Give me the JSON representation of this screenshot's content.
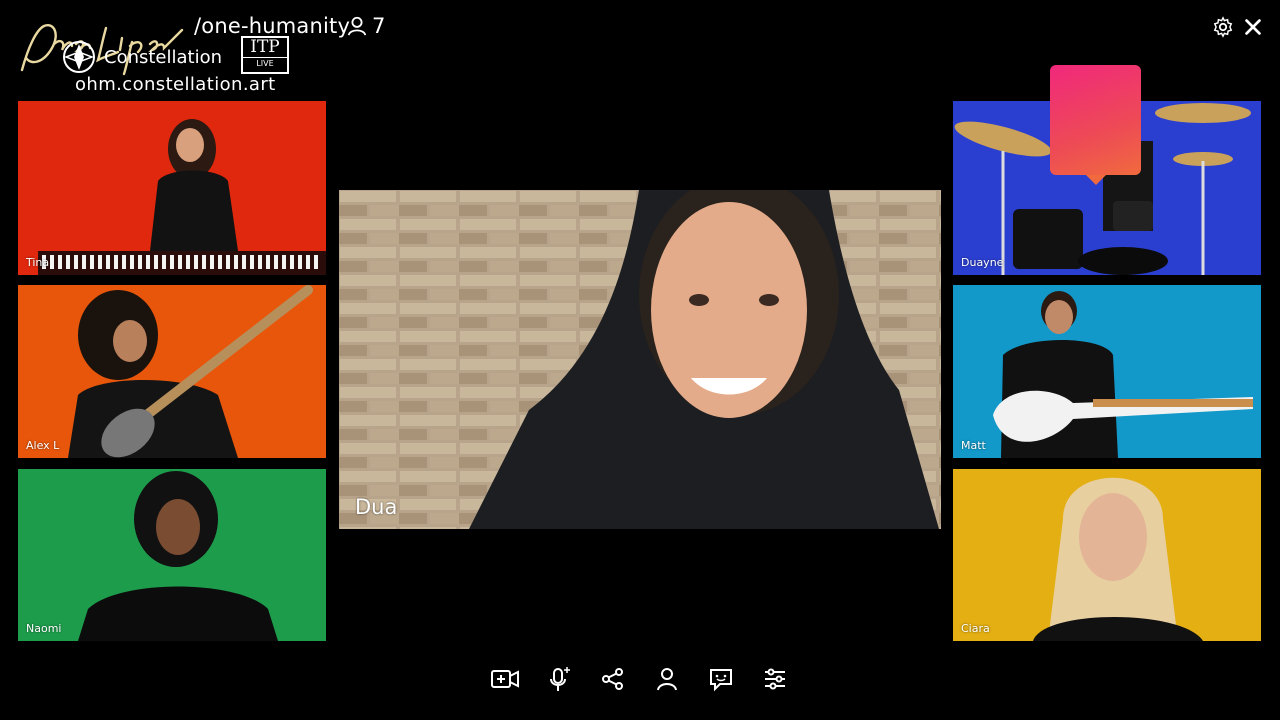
{
  "header": {
    "script_logo_text": "Dua Lipa",
    "room_title": "/one-humanity",
    "participant_count": "7",
    "brand_label": "Constellation",
    "itp_logo_text": "ITP",
    "itp_logo_sub": "LIVE",
    "url": "ohm.constellation.art"
  },
  "icons": {
    "settings": "gear-icon",
    "close": "close-icon",
    "participants": "user-icon"
  },
  "main_speaker": {
    "name": "Dua"
  },
  "tiles_left": [
    {
      "name": "Tina",
      "bg": "#e0280e"
    },
    {
      "name": "Alex L",
      "bg": "#e8560c"
    },
    {
      "name": "Naomi",
      "bg": "#1d9d4c"
    }
  ],
  "tiles_right": [
    {
      "name": "Duayne",
      "bg": "#2a3fd0"
    },
    {
      "name": "Matt",
      "bg": "#1299c9"
    },
    {
      "name": "Ciara",
      "bg": "#e3af12"
    }
  ],
  "toolbar": [
    {
      "name": "video-camera-icon"
    },
    {
      "name": "microphone-icon"
    },
    {
      "name": "share-icon"
    },
    {
      "name": "user-icon"
    },
    {
      "name": "chat-icon"
    },
    {
      "name": "settings-sliders-icon"
    }
  ],
  "colors": {
    "background": "#000000",
    "logo_gold": "#e9d9a0",
    "overlay_pink": "#f0287c"
  }
}
